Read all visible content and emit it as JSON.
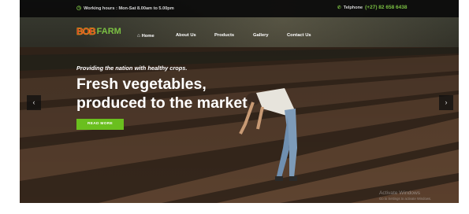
{
  "topbar": {
    "hours": "Working hours : Mon-Sat 8.00am to 5.00pm",
    "phone_label": "Telphone",
    "phone_number": "(+27) 82 658 6438"
  },
  "logo": {
    "part1": "BOB",
    "part2": "FARM"
  },
  "nav": [
    {
      "label": "Home",
      "icon": "home-icon"
    },
    {
      "label": "About Us"
    },
    {
      "label": "Products"
    },
    {
      "label": "Gallery"
    },
    {
      "label": "Contact Us"
    }
  ],
  "hero": {
    "subtitle": "Providing the nation with healthy crops.",
    "title_line1": "Fresh vegetables,",
    "title_line2": "produced to the market",
    "button": "READ MORE"
  },
  "carousel": {
    "prev": "‹",
    "next": "›"
  },
  "watermark": {
    "line1": "Activate Windows",
    "line2": "Go to Settings to activate Windows."
  },
  "colors": {
    "accent": "#6abf1e",
    "topbar": "#0a0a0a",
    "soil": "#4a3526"
  }
}
